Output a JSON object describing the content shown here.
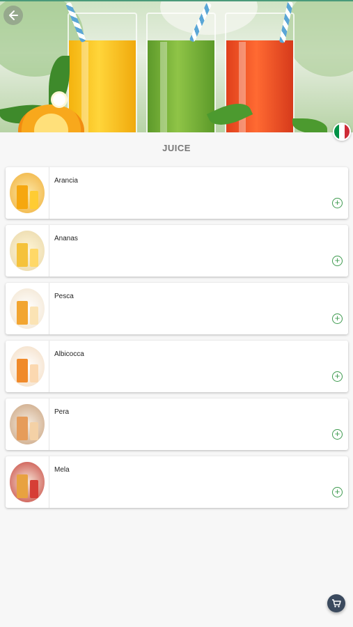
{
  "header": {
    "back_icon": "arrow-left-icon",
    "language_flag": "italy-flag-icon",
    "flag_colors": [
      "#009246",
      "#ffffff",
      "#ce2b37"
    ]
  },
  "section": {
    "title": "JUICE"
  },
  "items": [
    {
      "name": "Arancia",
      "thumb_colors": [
        "#f6a70f",
        "#ffcc33"
      ],
      "add_icon": "add-circle-icon"
    },
    {
      "name": "Ananas",
      "thumb_colors": [
        "#f5c23a",
        "#ffd867"
      ],
      "add_icon": "add-circle-icon"
    },
    {
      "name": "Pesca",
      "thumb_colors": [
        "#f2a531",
        "#fbe3b4"
      ],
      "add_icon": "add-circle-icon"
    },
    {
      "name": "Albicocca",
      "thumb_colors": [
        "#f08a2a",
        "#fbd8b0"
      ],
      "add_icon": "add-circle-icon"
    },
    {
      "name": "Pera",
      "thumb_colors": [
        "#e69c5a",
        "#f4d1a6"
      ],
      "add_icon": "add-circle-icon"
    },
    {
      "name": "Mela",
      "thumb_colors": [
        "#e8a240",
        "#d63e36"
      ],
      "add_icon": "add-circle-icon"
    }
  ],
  "cart": {
    "icon": "cart-icon",
    "color": "#3b4a5e"
  },
  "accent_color": "#3d9a4e"
}
